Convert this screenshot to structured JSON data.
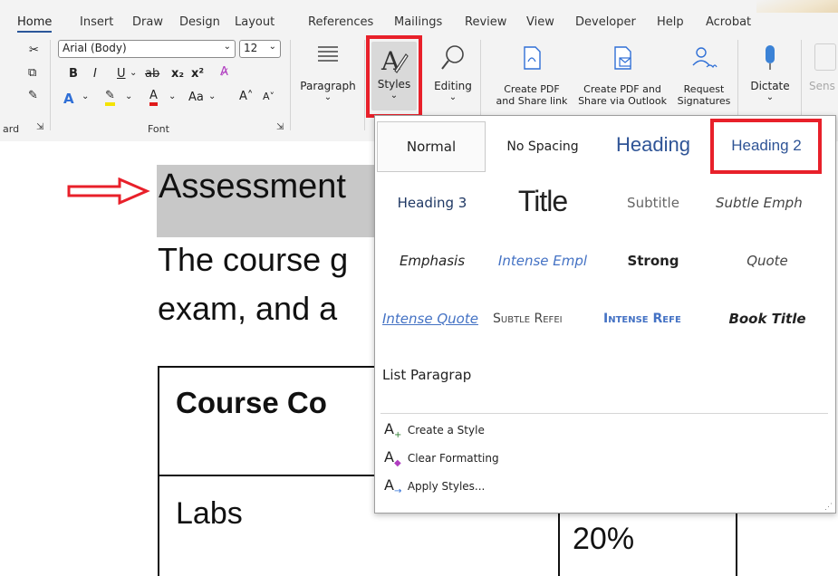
{
  "tabs": [
    "Home",
    "Insert",
    "Draw",
    "Design",
    "Layout",
    "References",
    "Mailings",
    "Review",
    "View",
    "Developer",
    "Help",
    "Acrobat"
  ],
  "ribbon": {
    "font_name": "Arial (Body)",
    "font_size": "12",
    "clipboard_label": "ard",
    "font_group_label": "Font",
    "paragraph_label": "Paragraph",
    "styles_label": "Styles",
    "editing_label": "Editing",
    "create_pdf_line1": "Create PDF",
    "create_pdf_line2": "and Share link",
    "create_pdf_outlook_line1": "Create PDF and",
    "create_pdf_outlook_line2": "Share via Outlook",
    "request_line1": "Request",
    "request_line2": "Signatures",
    "dictate_label": "Dictate",
    "sens_label": "Sens",
    "font_icons_row1": [
      "B",
      "I",
      "U",
      "ab",
      "x₂",
      "x²"
    ],
    "font_icons_row2": [
      "A",
      "A",
      "Aa",
      "A˄",
      "A˅"
    ]
  },
  "document": {
    "heading": "Assessment",
    "para_line1": "The course g",
    "para_line2": "exam, and a",
    "table_header": "Course Co",
    "table_row1_col1": "Labs",
    "table_row1_col2": "20%"
  },
  "styles_gallery": {
    "rows": [
      [
        "Normal",
        "No Spacing",
        "Heading",
        "Heading 2"
      ],
      [
        "Heading 3",
        "Title",
        "Subtitle",
        "Subtle Emph"
      ],
      [
        "Emphasis",
        "Intense Empl",
        "Strong",
        "Quote"
      ],
      [
        "Intense Quote",
        "Subtle Refei",
        "Intense Refe",
        "Book Title"
      ],
      [
        "List Paragrap"
      ]
    ],
    "actions": [
      "Create a Style",
      "Clear Formatting",
      "Apply Styles..."
    ]
  },
  "colors": {
    "highlight_box": "#e8202a",
    "heading_blue": "#2f5496",
    "arrow_red": "#e8202a"
  }
}
